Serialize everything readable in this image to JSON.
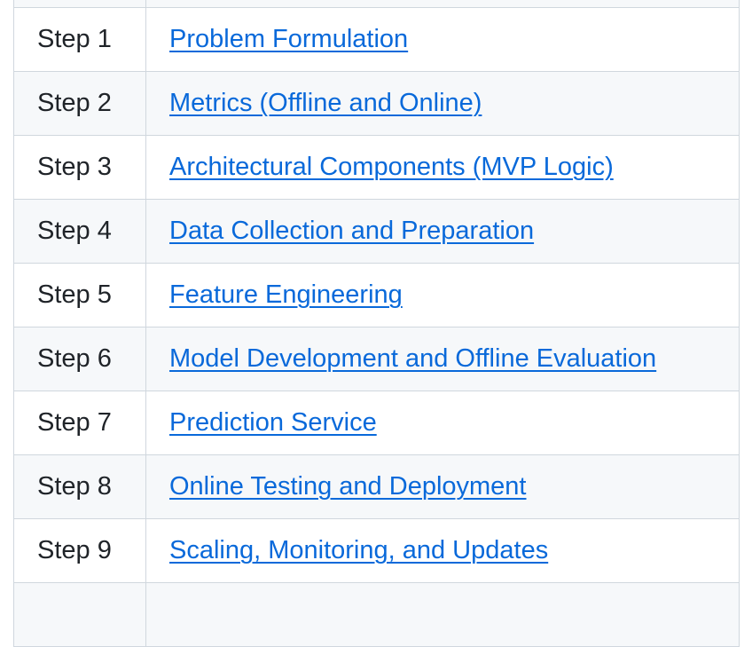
{
  "table": {
    "rows": [
      {
        "step": "",
        "title": ""
      },
      {
        "step": "Step 1",
        "title": "Problem Formulation"
      },
      {
        "step": "Step 2",
        "title": "Metrics (Offline and Online)"
      },
      {
        "step": "Step 3",
        "title": "Architectural Components (MVP Logic)"
      },
      {
        "step": "Step 4",
        "title": "Data Collection and Preparation"
      },
      {
        "step": "Step 5",
        "title": "Feature Engineering"
      },
      {
        "step": "Step 6",
        "title": "Model Development and Offline Evaluation"
      },
      {
        "step": "Step 7",
        "title": "Prediction Service"
      },
      {
        "step": "Step 8",
        "title": "Online Testing and Deployment"
      },
      {
        "step": "Step 9",
        "title": "Scaling, Monitoring, and Updates"
      },
      {
        "step": "",
        "title": ""
      }
    ]
  },
  "colors": {
    "link": "#0969da",
    "border": "#d0d7de",
    "alt_row_bg": "#f6f8fa",
    "text": "#1f2328"
  }
}
